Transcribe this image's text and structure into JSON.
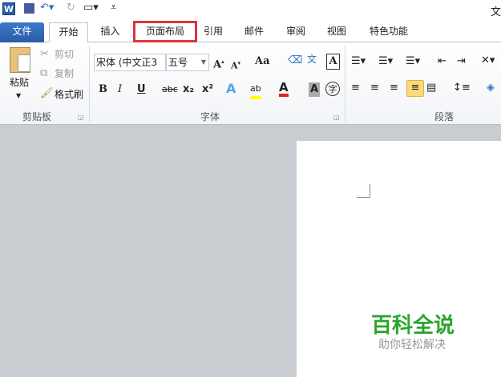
{
  "title_partial": "文",
  "quick_access": {
    "app_icon": "word-icon",
    "save": "save-icon",
    "undo": "undo-icon",
    "redo": "redo-icon",
    "print_preview": "print-preview-icon",
    "customize": "customize-icon"
  },
  "tabs": [
    {
      "label": "文件"
    },
    {
      "label": "开始"
    },
    {
      "label": "插入"
    },
    {
      "label": "页面布局"
    },
    {
      "label": "引用"
    },
    {
      "label": "邮件"
    },
    {
      "label": "审阅"
    },
    {
      "label": "视图"
    },
    {
      "label": "特色功能"
    }
  ],
  "clipboard": {
    "paste": "粘贴",
    "cut": "剪切",
    "copy": "复制",
    "format_painter": "格式刷",
    "group": "剪贴板"
  },
  "font": {
    "name": "宋体 (中文正3",
    "size": "五号",
    "group": "字体",
    "bold": "B",
    "italic": "I",
    "underline": "U",
    "strike": "abc",
    "sub": "x₂",
    "sup": "x²",
    "case": "Aa"
  },
  "paragraph": {
    "group": "段落"
  },
  "watermark": {
    "title": "百科全说",
    "subtitle": "助你轻松解决"
  },
  "colors": {
    "file_tab": "#2a5ca8",
    "highlight_box": "#d9363e",
    "watermark_green": "#2aa52e"
  }
}
